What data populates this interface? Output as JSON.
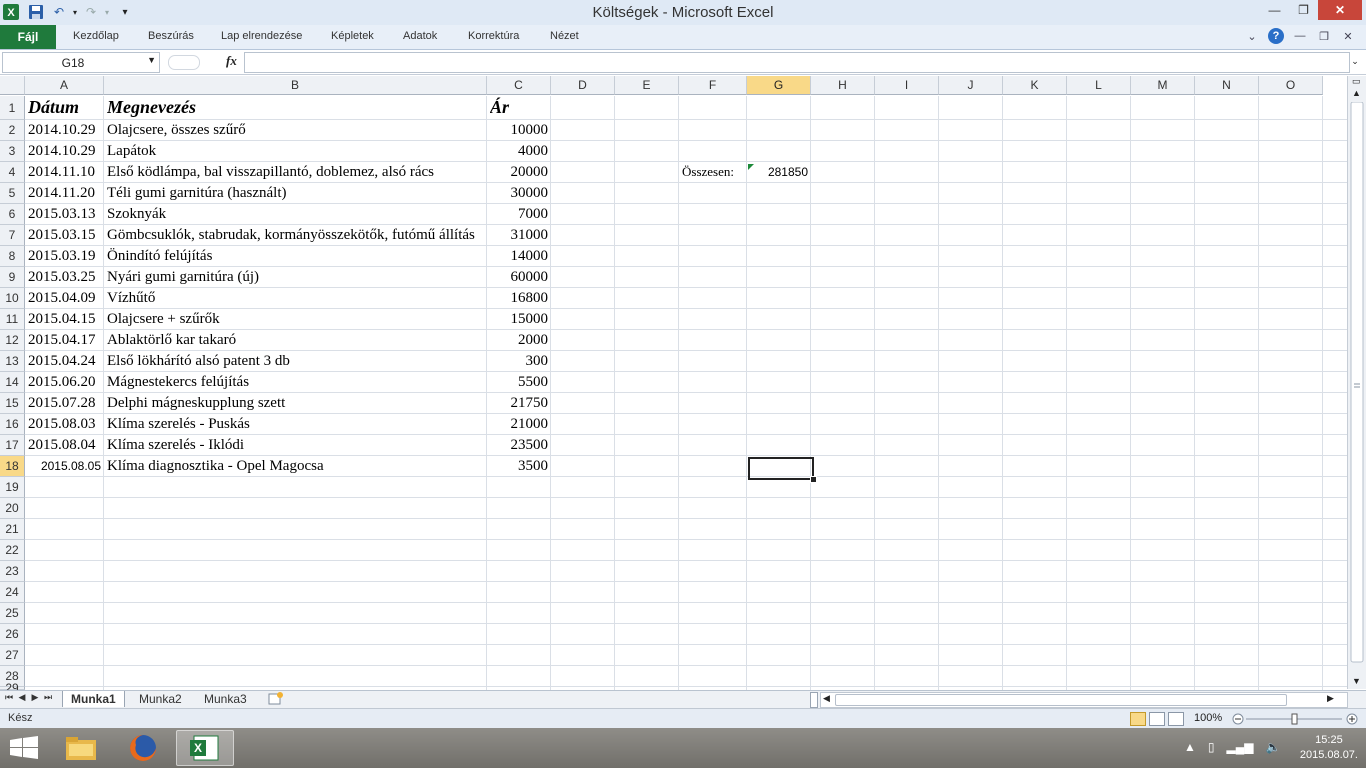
{
  "window": {
    "title": "Költségek - Microsoft Excel"
  },
  "ribbon": {
    "file_label": "Fájl",
    "tabs": [
      "Kezdőlap",
      "Beszúrás",
      "Lap elrendezése",
      "Képletek",
      "Adatok",
      "Korrektúra",
      "Nézet"
    ]
  },
  "formula_bar": {
    "name_box": "G18",
    "fx_label": "fx",
    "content": ""
  },
  "columns": [
    "A",
    "B",
    "C",
    "D",
    "E",
    "F",
    "G",
    "H",
    "I",
    "J",
    "K",
    "L",
    "M",
    "N",
    "O"
  ],
  "selected_column": "G",
  "selected_row": 18,
  "rows": [
    "1",
    "2",
    "3",
    "4",
    "5",
    "6",
    "7",
    "8",
    "9",
    "10",
    "11",
    "12",
    "13",
    "14",
    "15",
    "16",
    "17",
    "18",
    "19",
    "20",
    "21",
    "22",
    "23",
    "24",
    "25",
    "26",
    "27",
    "28",
    "29"
  ],
  "table": {
    "headers": [
      "Dátum",
      "Megnevezés",
      "Ár"
    ],
    "records": [
      [
        "2014.10.29",
        "Olajcsere, összes szűrő",
        "10000"
      ],
      [
        "2014.10.29",
        "Lapátok",
        "4000"
      ],
      [
        "2014.11.10",
        "Első ködlámpa, bal visszapillantó, doblemez, alsó rács",
        "20000"
      ],
      [
        "2014.11.20",
        "Téli gumi garnitúra (használt)",
        "30000"
      ],
      [
        "2015.03.13",
        "Szoknyák",
        "7000"
      ],
      [
        "2015.03.15",
        "Gömbcsuklók, stabrudak, kormányösszekötők, futómű állítás",
        "31000"
      ],
      [
        "2015.03.19",
        "Önindító felújítás",
        "14000"
      ],
      [
        "2015.03.25",
        "Nyári gumi garnitúra (új)",
        "60000"
      ],
      [
        "2015.04.09",
        "Vízhűtő",
        "16800"
      ],
      [
        "2015.04.15",
        "Olajcsere + szűrők",
        "15000"
      ],
      [
        "2015.04.17",
        "Ablaktörlő kar takaró",
        "2000"
      ],
      [
        "2015.04.24",
        "Első lökhárító alsó patent 3 db",
        "300"
      ],
      [
        "2015.06.20",
        "Mágnestekercs felújítás",
        "5500"
      ],
      [
        "2015.07.28",
        "Delphi mágneskupplung szett",
        "21750"
      ],
      [
        "2015.08.03",
        "Klíma szerelés - Puskás",
        "21000"
      ],
      [
        "2015.08.04",
        "Klíma szerelés - Iklódi",
        "23500"
      ],
      [
        "2015.08.05",
        "Klíma diagnosztika - Opel Magocsa",
        "3500"
      ]
    ]
  },
  "summary": {
    "label": "Összesen:",
    "value": "281850"
  },
  "sheets": [
    "Munka1",
    "Munka2",
    "Munka3"
  ],
  "active_sheet": "Munka1",
  "status": {
    "text": "Kész",
    "zoom": "100%"
  },
  "taskbar": {
    "time": "15:25",
    "date": "2015.08.07."
  },
  "colors": {
    "excel_green": "#1f7a3c",
    "selection_header": "#f9d988"
  }
}
